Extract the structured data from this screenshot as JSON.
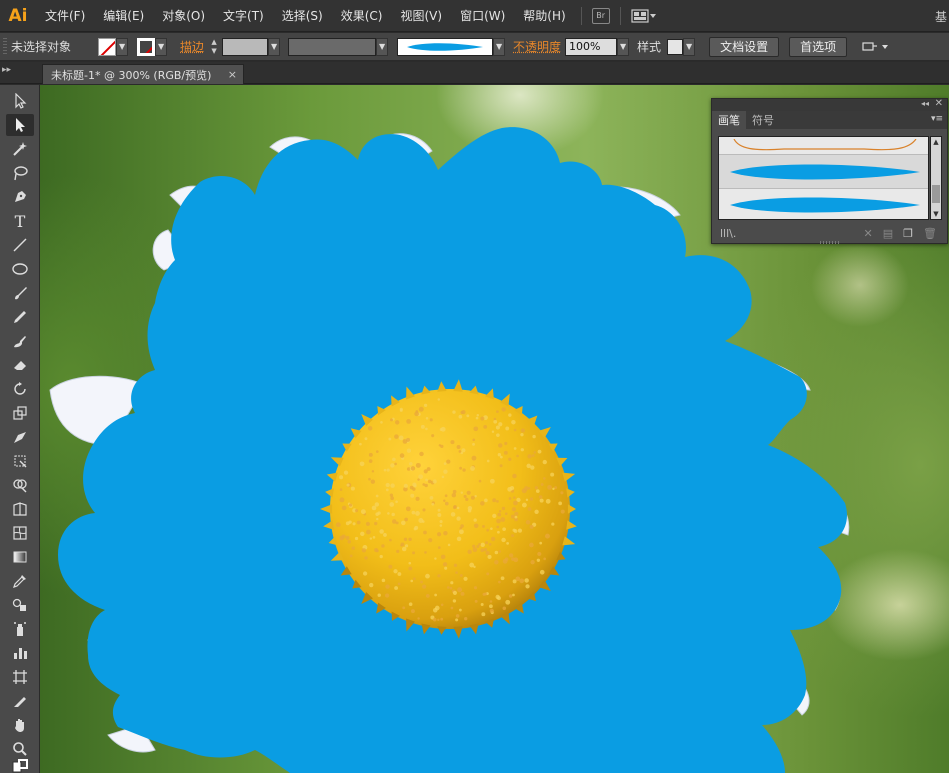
{
  "app": {
    "logo": "Ai",
    "workspace_partial": "基"
  },
  "menu": [
    "文件(F)",
    "编辑(E)",
    "对象(O)",
    "文字(T)",
    "选择(S)",
    "效果(C)",
    "视图(V)",
    "窗口(W)",
    "帮助(H)"
  ],
  "menubar_icons": {
    "bridge": "Br",
    "arrange": "arrange-documents-icon"
  },
  "control": {
    "selection_status": "未选择对象",
    "stroke_label": "描边",
    "opacity_label": "不透明度",
    "opacity_value": "100%",
    "style_label": "样式",
    "doc_setup": "文档设置",
    "preferences": "首选项"
  },
  "document": {
    "tab_title": "未标题-1* @ 300% (RGB/预览)",
    "close": "×"
  },
  "panel": {
    "tabs": [
      "画笔",
      "符号"
    ],
    "brush_count": 3,
    "library_label": "lll\\."
  },
  "colors": {
    "petal_blue": "#0a9de3",
    "center_yellow": "#f2be19",
    "ui_dark": "#333333",
    "accent_orange": "#e8872a"
  },
  "tools": [
    "selection-tool",
    "direct-selection-tool",
    "magic-wand-tool",
    "lasso-tool",
    "pen-tool",
    "type-tool",
    "line-segment-tool",
    "ellipse-tool",
    "paintbrush-tool",
    "pencil-tool",
    "blob-brush-tool",
    "eraser-tool",
    "rotate-tool",
    "scale-tool",
    "warp-tool",
    "free-transform-tool",
    "shape-builder-tool",
    "perspective-grid-tool",
    "mesh-tool",
    "gradient-tool",
    "eyedropper-tool",
    "blend-tool",
    "symbol-sprayer-tool",
    "column-graph-tool",
    "artboard-tool",
    "slice-tool",
    "hand-tool",
    "zoom-tool",
    "fill-stroke-swatch"
  ]
}
